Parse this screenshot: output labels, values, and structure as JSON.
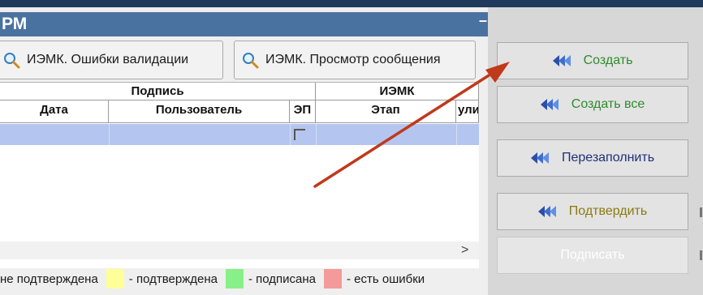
{
  "window": {
    "title": "РМ",
    "minimize_label": "–"
  },
  "toolbar": {
    "validation_errors_label": "ИЭМК. Ошибки валидации",
    "view_message_label": "ИЭМК. Просмотр сообщения"
  },
  "table": {
    "group_headers": {
      "signature": "Подпись",
      "iemk": "ИЭМК"
    },
    "columns": {
      "date": "Дата",
      "user": "Пользователь",
      "ep": "ЭП",
      "stage": "Этап",
      "truncated": "ули"
    }
  },
  "legend": {
    "not_confirmed": "не подтверждена",
    "confirmed": "- подтверждена",
    "signed": "- подписана",
    "has_errors": "- есть ошибки",
    "colors": {
      "confirmed": "#ffff99",
      "signed": "#88f088",
      "has_errors": "#f59a9a"
    }
  },
  "side_buttons": {
    "create": {
      "label": "Создать",
      "color": "#2e8b2e"
    },
    "create_all": {
      "label": "Создать все",
      "color": "#2e8b2e"
    },
    "refill": {
      "label": "Перезаполнить",
      "color": "#1f2f7a"
    },
    "confirm": {
      "label": "Подтвердить",
      "color": "#8a7a10"
    },
    "sign": {
      "label": "Подписать",
      "color": "#ffffff"
    }
  },
  "colors": {
    "accent": "#4a72a0",
    "selection": "#b4c6ef",
    "annotation_arrow": "#c0391b"
  }
}
